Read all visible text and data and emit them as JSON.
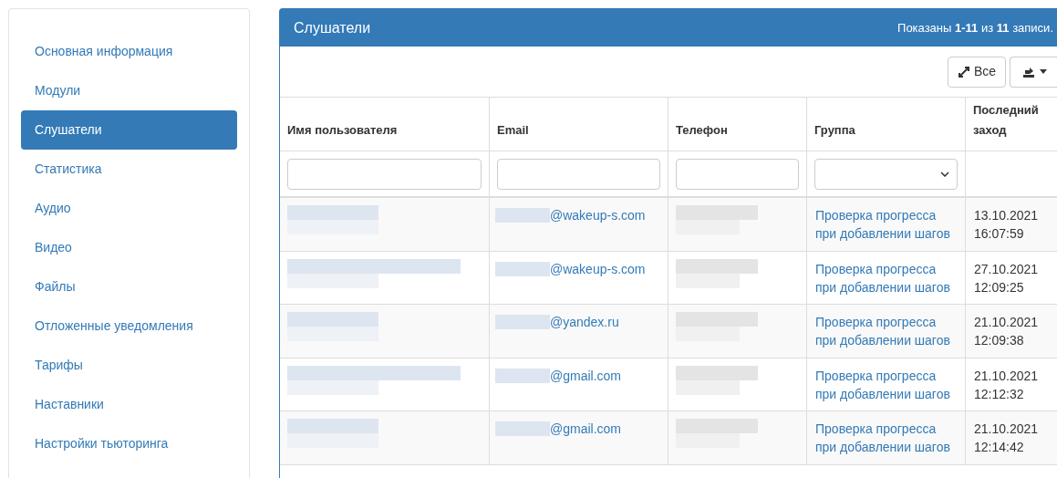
{
  "sidebar": {
    "items": [
      {
        "label": "Основная информация",
        "selected": false
      },
      {
        "label": "Модули",
        "selected": false
      },
      {
        "label": "Слушатели",
        "selected": true
      },
      {
        "label": "Статистика",
        "selected": false
      },
      {
        "label": "Аудио",
        "selected": false
      },
      {
        "label": "Видео",
        "selected": false
      },
      {
        "label": "Файлы",
        "selected": false
      },
      {
        "label": "Отложенные уведомления",
        "selected": false
      },
      {
        "label": "Тарифы",
        "selected": false
      },
      {
        "label": "Наставники",
        "selected": false
      },
      {
        "label": "Настройки тьюторинга",
        "selected": false
      }
    ]
  },
  "panel": {
    "title": "Слушатели",
    "summary": "Показаны **1-11** из **11** записи.",
    "toolbar": {
      "all_button": "Все"
    },
    "table": {
      "columns": [
        "Имя пользователя",
        "Email",
        "Телефон",
        "Группа",
        "Последний заход"
      ],
      "rows": [
        {
          "email_domain": "@wakeup-s.com",
          "group": "Проверка прогресса при добавлении шагов",
          "last_login": [
            "13.10.2021",
            "16:07:59"
          ]
        },
        {
          "email_domain": "@wakeup-s.com",
          "group": "Проверка прогресса при добавлении шагов",
          "last_login": [
            "27.10.2021",
            "12:09:25"
          ]
        },
        {
          "email_domain": "@yandex.ru",
          "group": "Проверка прогресса при добавлении шагов",
          "last_login": [
            "21.10.2021",
            "12:09:38"
          ]
        },
        {
          "email_domain": "@gmail.com",
          "group": "Проверка прогресса при добавлении шагов",
          "last_login": [
            "21.10.2021",
            "12:12:32"
          ]
        },
        {
          "email_domain": "@gmail.com",
          "group": "Проверка прогресса при добавлении шагов",
          "last_login": [
            "21.10.2021",
            "12:14:42"
          ]
        }
      ]
    }
  }
}
